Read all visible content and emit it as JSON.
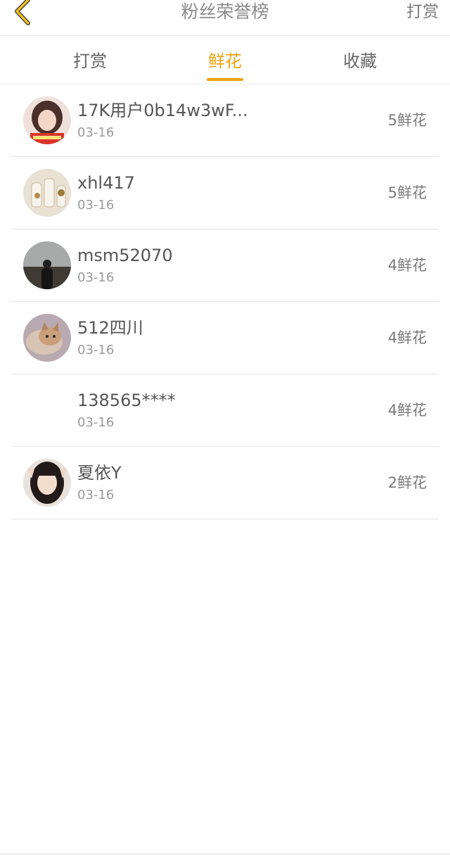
{
  "header": {
    "title": "粉丝荣誉榜",
    "action_label": "打赏",
    "back_icon": "chevron-left-icon",
    "accent_color": "#f2a20f"
  },
  "tabs": [
    {
      "label": "打赏",
      "active": false
    },
    {
      "label": "鲜花",
      "active": true
    },
    {
      "label": "收藏",
      "active": false
    }
  ],
  "rows": [
    {
      "name": "17K用户0b14w3wF...",
      "date": "03-16",
      "count": "5鲜花",
      "avatar": "avatar-photo-girl"
    },
    {
      "name": "xhl417",
      "date": "03-16",
      "count": "5鲜花",
      "avatar": "avatar-photo-bottles"
    },
    {
      "name": "msm52070",
      "date": "03-16",
      "count": "4鲜花",
      "avatar": "avatar-photo-landscape"
    },
    {
      "name": "512四川",
      "date": "03-16",
      "count": "4鲜花",
      "avatar": "avatar-photo-cat"
    },
    {
      "name": "138565****",
      "date": "03-16",
      "count": "4鲜花",
      "avatar": "avatar-empty"
    },
    {
      "name": "夏依Y",
      "date": "03-16",
      "count": "2鲜花",
      "avatar": "avatar-photo-portrait"
    }
  ]
}
